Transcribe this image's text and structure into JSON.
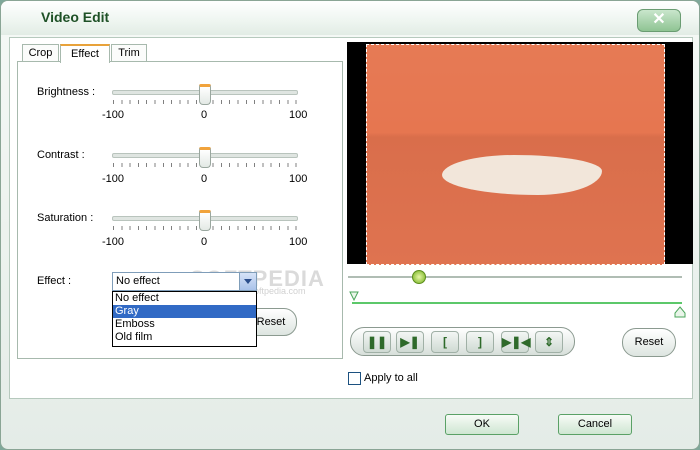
{
  "window": {
    "title": "Video Edit",
    "close_label": "✕"
  },
  "tabs": [
    {
      "label": "Crop"
    },
    {
      "label": "Effect"
    },
    {
      "label": "Trim"
    }
  ],
  "adjustments": {
    "brightness": {
      "label": "Brightness :",
      "min": "-100",
      "mid": "0",
      "max": "100",
      "value": 0
    },
    "contrast": {
      "label": "Contrast :",
      "min": "-100",
      "mid": "0",
      "max": "100",
      "value": 0
    },
    "saturation": {
      "label": "Saturation :",
      "min": "-100",
      "mid": "0",
      "max": "100",
      "value": 0
    }
  },
  "effect": {
    "label": "Effect :",
    "selected": "No effect",
    "options": [
      "No effect",
      "Gray",
      "Emboss",
      "Old film"
    ],
    "highlighted": "Gray"
  },
  "watermark": {
    "text": "SOFTPEDIA",
    "sub": "www.softpedia.com"
  },
  "buttons": {
    "reset": "Reset",
    "reset_preview": "Reset",
    "ok": "OK",
    "cancel": "Cancel"
  },
  "playback": {
    "controls": [
      "pause-icon",
      "play-frame-icon",
      "mark-in-icon",
      "mark-out-icon",
      "next-frame-icon",
      "fit-icon"
    ]
  },
  "apply_to_all": {
    "label": "Apply to all",
    "checked": false
  },
  "colors": {
    "accent": "#f1a33c",
    "title": "#1e5126",
    "selection": "#316ac5",
    "video": "#e67a55"
  }
}
